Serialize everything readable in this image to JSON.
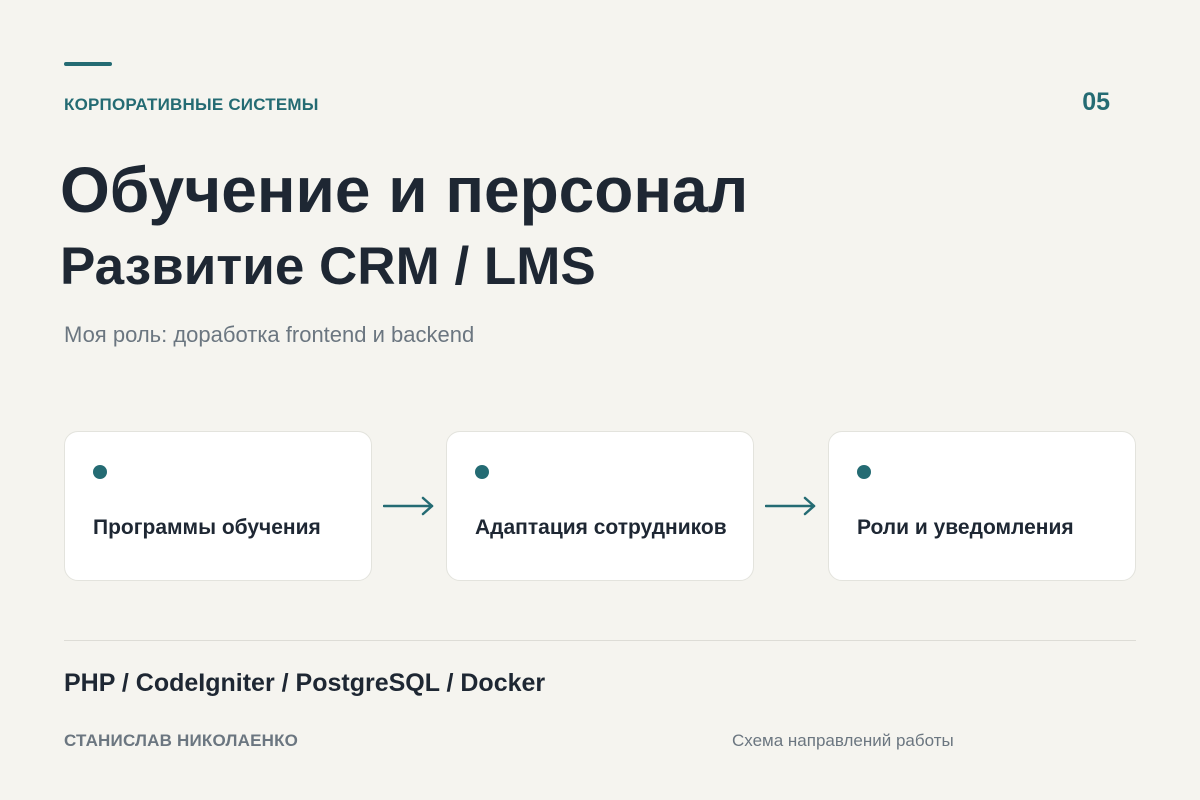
{
  "header": {
    "section_label": "КОРПОРАТИВНЫЕ СИСТЕМЫ",
    "slide_number": "05",
    "accent_color": "#246b73"
  },
  "title": "Обучение и персонал",
  "subtitle": "Развитие CRM / LMS",
  "role": "Моя роль: доработка frontend и backend",
  "flow": {
    "steps": [
      {
        "label": "Программы обучения"
      },
      {
        "label": "Адаптация сотрудников"
      },
      {
        "label": "Роли и уведомления"
      }
    ],
    "connector_icon": "arrow-right-icon"
  },
  "footer": {
    "stack": "PHP / CodeIgniter / PostgreSQL / Docker",
    "author": "СТАНИСЛАВ НИКОЛАЕНКО",
    "caption": "Схема направлений работы"
  }
}
